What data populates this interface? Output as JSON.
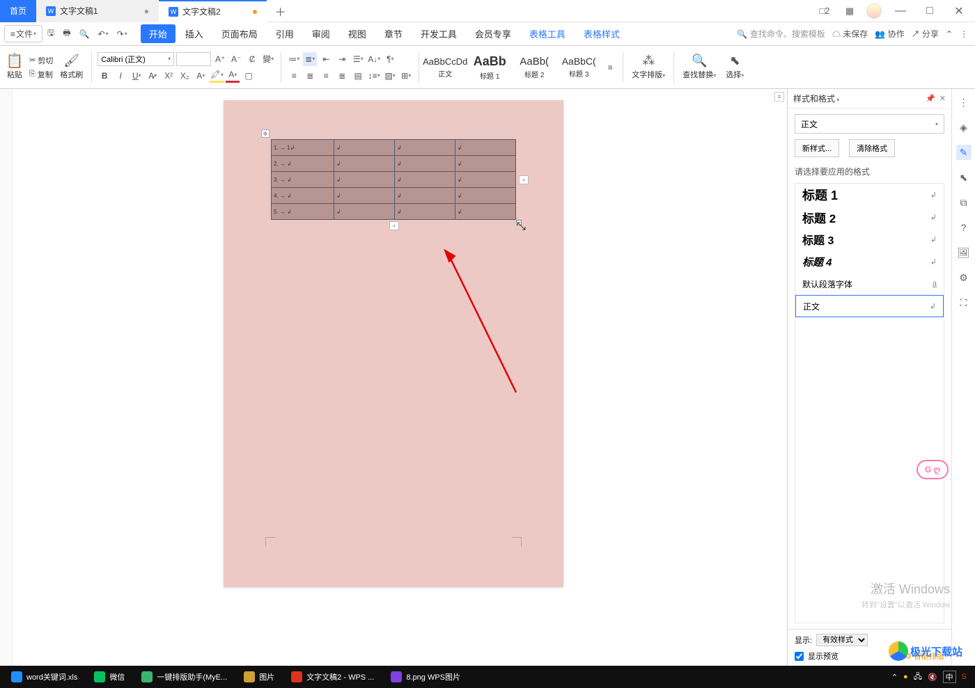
{
  "tabs": {
    "home": "首页",
    "doc1": "文字文稿1",
    "doc2": "文字文稿2"
  },
  "titleicons": {
    "grid1": "⊞",
    "grid2": "▦"
  },
  "menu": {
    "file": "文件",
    "tabs": [
      "开始",
      "插入",
      "页面布局",
      "引用",
      "审阅",
      "视图",
      "章节",
      "开发工具",
      "会员专享",
      "表格工具",
      "表格样式"
    ],
    "search_placeholder": "查找命令、搜索模板",
    "unsaved": "未保存",
    "coop": "协作",
    "share": "分享"
  },
  "ribbon": {
    "paste": "粘贴",
    "cut": "剪切",
    "copy": "复制",
    "brush": "格式刷",
    "font": "Calibri (正文)",
    "styles": {
      "body_preview": "AaBbCcDd",
      "body_label": "正文",
      "h1_preview": "AaBb",
      "h1_label": "标题 1",
      "h2_preview": "AaBb(",
      "h2_label": "标题 2",
      "h3_preview": "AaBbC(",
      "h3_label": "标题 3"
    },
    "layout": "文字排版",
    "findrep": "查找替换",
    "select": "选择"
  },
  "table": {
    "rows": [
      "1. → 1↲",
      "2. → ↲",
      "3. → ↲",
      "4. → ↲",
      "5. → ↲"
    ],
    "cellmark": "↲"
  },
  "panel": {
    "title": "样式和格式",
    "current": "正文",
    "new_style": "新样式...",
    "clear": "清除格式",
    "prompt": "请选择要应用的格式",
    "h1": "标题 1",
    "h2": "标题 2",
    "h3": "标题 3",
    "h4": "标题 4",
    "default_font": "默认段落字体",
    "body": "正文",
    "show": "显示:",
    "show_value": "有效样式",
    "preview_cb": "显示预览",
    "smart": "智能排版"
  },
  "watermark": {
    "line1": "激活 Windows",
    "line2": "转到\"设置\"以激活 Window"
  },
  "logo_text": "极光下载站",
  "chat": "G ღ",
  "taskbar": {
    "items": [
      {
        "label": "word关键词.xls",
        "color": "#1e90ff"
      },
      {
        "label": "微信",
        "color": "#07c160"
      },
      {
        "label": "一键排版助手(MyE...",
        "color": "#3cb371"
      },
      {
        "label": "图片",
        "color": "#d0a030"
      },
      {
        "label": "文字文稿2 - WPS ...",
        "color": "#e03020"
      },
      {
        "label": "8.png  WPS图片",
        "color": "#8040e0"
      }
    ],
    "ime": "中"
  }
}
